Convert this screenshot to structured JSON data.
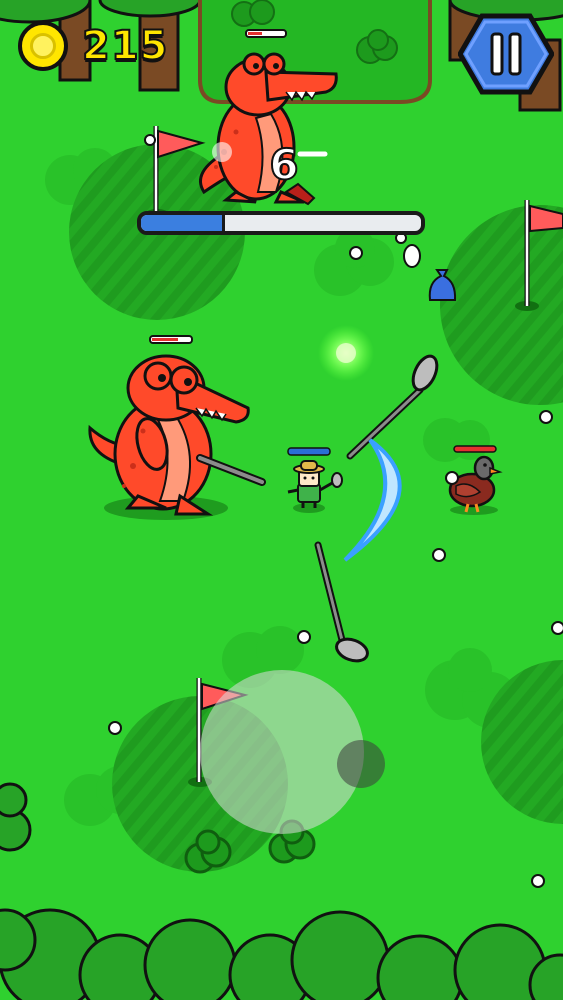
{
  "hud": {
    "coins": "215",
    "wave_number": "6",
    "wave_progress": 0.3,
    "pause_icon": "pause-icon",
    "coin_icon": "gold-coin-icon"
  },
  "colors": {
    "grass": "#2fd12f",
    "green_dark": "#23a923",
    "croc": "#ff4a2a",
    "progress_fill": "#3b7fe0",
    "pause_button": "#3f7ce0"
  },
  "entities": {
    "player": "golfer-player",
    "enemies": [
      "giant-crocodile",
      "giant-crocodile",
      "duck"
    ],
    "weapons": [
      "golf-club",
      "golf-club",
      "golf-club"
    ],
    "effects": [
      "swing-slash",
      "xp-orb"
    ],
    "pickups": [
      "blue-loot-bag",
      "egg"
    ],
    "flags": [
      "red-golf-flag",
      "red-golf-flag",
      "red-golf-flag"
    ]
  },
  "controls": {
    "joystick": "virtual-joystick"
  }
}
